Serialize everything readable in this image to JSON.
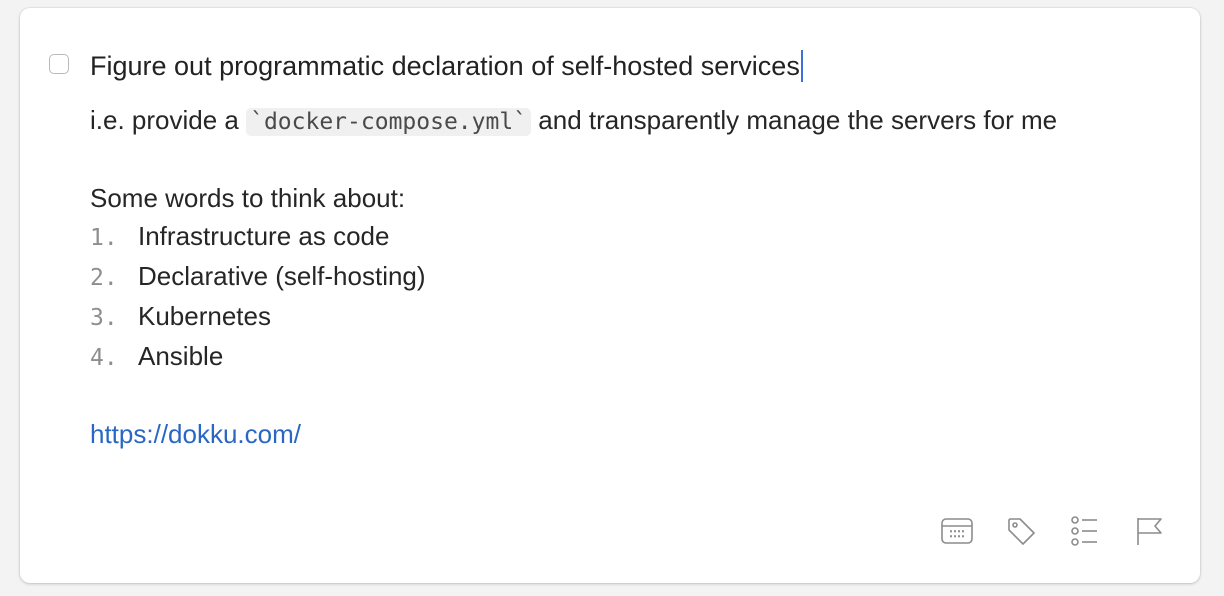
{
  "task": {
    "completed": false,
    "title": "Figure out programmatic declaration of self-hosted services"
  },
  "notes": {
    "intro_before": "i.e. provide a ",
    "intro_code": "`docker-compose.yml`",
    "intro_after": " and transparently manage the servers for me",
    "list_heading": "Some words to think about:",
    "list": [
      {
        "num": "1.",
        "text": "Infrastructure as code"
      },
      {
        "num": "2.",
        "text": "Declarative (self-hosting)"
      },
      {
        "num": "3.",
        "text": "Kubernetes"
      },
      {
        "num": "4.",
        "text": "Ansible"
      }
    ],
    "link": "https://dokku.com/"
  },
  "toolbar": {
    "icons": [
      "calendar-icon",
      "tag-icon",
      "checklist-icon",
      "flag-icon"
    ]
  },
  "colors": {
    "link": "#2a67c4",
    "caret": "#3d6fe0",
    "icon": "#8c8c8c"
  }
}
